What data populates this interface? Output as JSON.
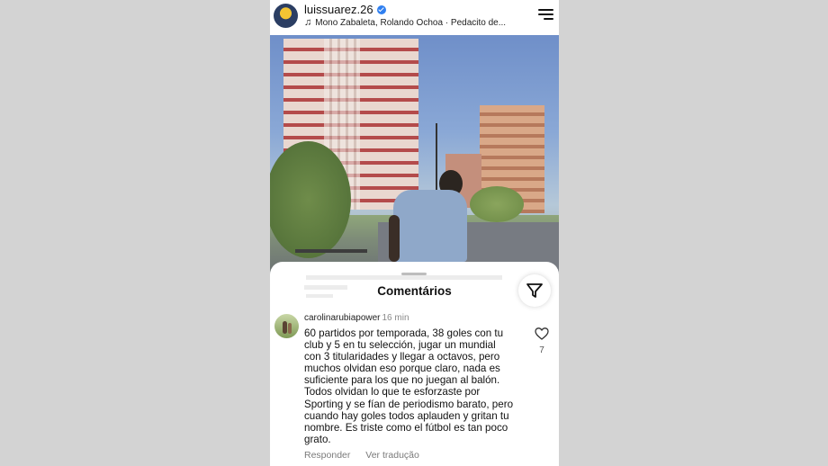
{
  "post": {
    "username": "luissuarez.26",
    "music": "Mono Zabaleta, Rolando Ochoa · Pedacito de..."
  },
  "comments_sheet": {
    "title": "Comentários",
    "comment": {
      "username": "carolinarubiapower",
      "time": "16 min",
      "text_lines": [
        "60 partidos por temporada, 38 goles con tu",
        "club y 5 en tu selección, jugar un mundial",
        "con 3 titularidades y llegar a octavos, pero",
        "muchos olvidan eso porque claro, nada es",
        "suficiente para los que no juegan al balón.",
        "Todos olvidan lo que te esforzaste por",
        "Sporting y se fían de periodismo barato, pero",
        "cuando hay goles todos aplauden y gritan tu",
        "nombre. Es triste como el fútbol es tan poco",
        "grato."
      ],
      "likes": "7",
      "reply_label": "Responder",
      "translate_label": "Ver tradução"
    }
  },
  "icons": {
    "verified": "verified-badge-icon",
    "music": "music-note-icon",
    "menu": "menu-icon",
    "filter": "filter-send-icon",
    "like": "heart-icon"
  },
  "colors": {
    "verified_blue": "#2f7ff0",
    "background_gray": "#d3d3d3"
  }
}
